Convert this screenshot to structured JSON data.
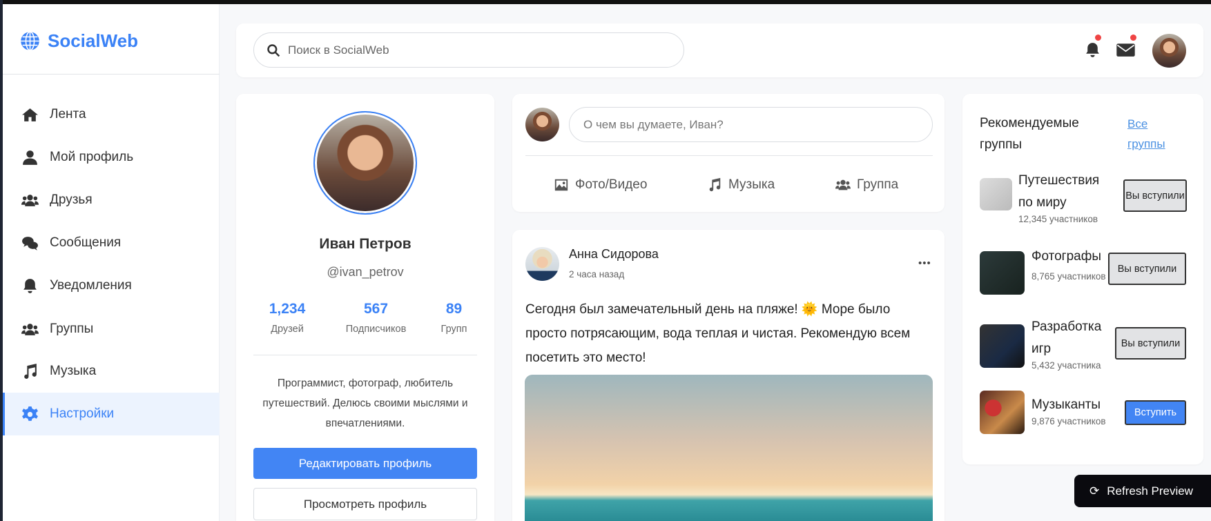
{
  "app": {
    "name": "SocialWeb",
    "brand_color": "#3b82f6"
  },
  "sidebar": {
    "items": [
      {
        "label": "Лента",
        "icon": "home-icon"
      },
      {
        "label": "Мой профиль",
        "icon": "user-icon"
      },
      {
        "label": "Друзья",
        "icon": "users-icon"
      },
      {
        "label": "Сообщения",
        "icon": "comments-icon"
      },
      {
        "label": "Уведомления",
        "icon": "bell-icon"
      },
      {
        "label": "Группы",
        "icon": "users-icon"
      },
      {
        "label": "Музыка",
        "icon": "music-icon"
      },
      {
        "label": "Настройки",
        "icon": "gear-icon",
        "active": true
      }
    ]
  },
  "header": {
    "search_placeholder": "Поиск в SocialWeb"
  },
  "profile": {
    "name": "Иван Петров",
    "handle": "@ivan_petrov",
    "stats": [
      {
        "value": "1,234",
        "label": "Друзей"
      },
      {
        "value": "567",
        "label": "Подписчиков"
      },
      {
        "value": "89",
        "label": "Групп"
      }
    ],
    "bio": "Программист, фотограф, любитель путешествий. Делюсь своими мыслями и впечатлениями.",
    "edit_label": "Редактировать профиль",
    "view_label": "Просмотреть профиль"
  },
  "composer": {
    "placeholder": "О чем вы думаете, Иван?",
    "actions": [
      "Фото/Видео",
      "Музыка",
      "Группа"
    ]
  },
  "post": {
    "author": "Анна Сидорова",
    "time": "2 часа назад",
    "text": "Сегодня был замечательный день на пляже! 🌞 Море было просто потрясающим, вода теплая и чистая. Рекомендую всем посетить это место!"
  },
  "groups": {
    "title": "Рекомендуемые группы",
    "all_link": "Все группы",
    "items": [
      {
        "name": "Путешествия по миру",
        "count": "12,345 участников",
        "button": "Вы вступили",
        "joined": true
      },
      {
        "name": "Фотографы",
        "count": "8,765 участников",
        "button": "Вы вступили",
        "joined": true
      },
      {
        "name": "Разработка игр",
        "count": "5,432 участника",
        "button": "Вы вступили",
        "joined": true
      },
      {
        "name": "Музыканты",
        "count": "9,876 участников",
        "button": "Вступить",
        "joined": false
      }
    ]
  },
  "refresh_label": "Refresh Preview"
}
